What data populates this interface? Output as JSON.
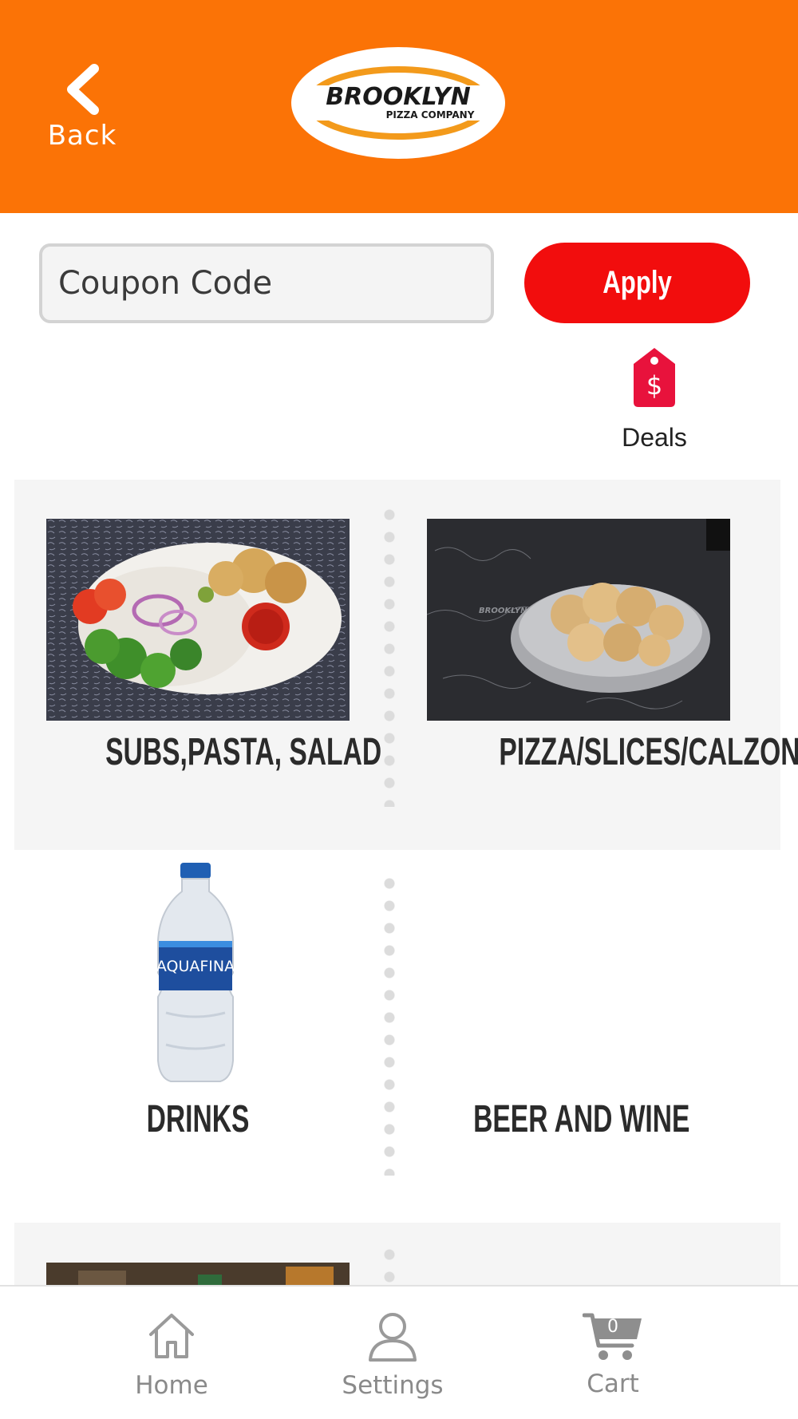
{
  "header": {
    "back_label": "Back",
    "logo_line1": "BROOKLYN",
    "logo_line2": "PIZZA COMPANY",
    "background_color": "#fb7306"
  },
  "coupon": {
    "placeholder": "Coupon Code",
    "value": "",
    "apply_label": "Apply",
    "apply_color": "#f20d0d"
  },
  "deals": {
    "label": "Deals",
    "icon": "price-tag-dollar-icon"
  },
  "categories": [
    {
      "label": "SUBS,PASTA, SALAD",
      "image": "salad-plate-photo"
    },
    {
      "label": "PIZZA/SLICES/CALZONES",
      "image": "garlic-knots-tin-photo"
    },
    {
      "label": "DRINKS",
      "image": "aquafina-bottle-photo",
      "image_text": "AQUAFINA"
    },
    {
      "label": "BEER AND WINE",
      "image": ""
    }
  ],
  "nav": {
    "home_label": "Home",
    "settings_label": "Settings",
    "cart_label": "Cart",
    "cart_count": "0"
  }
}
